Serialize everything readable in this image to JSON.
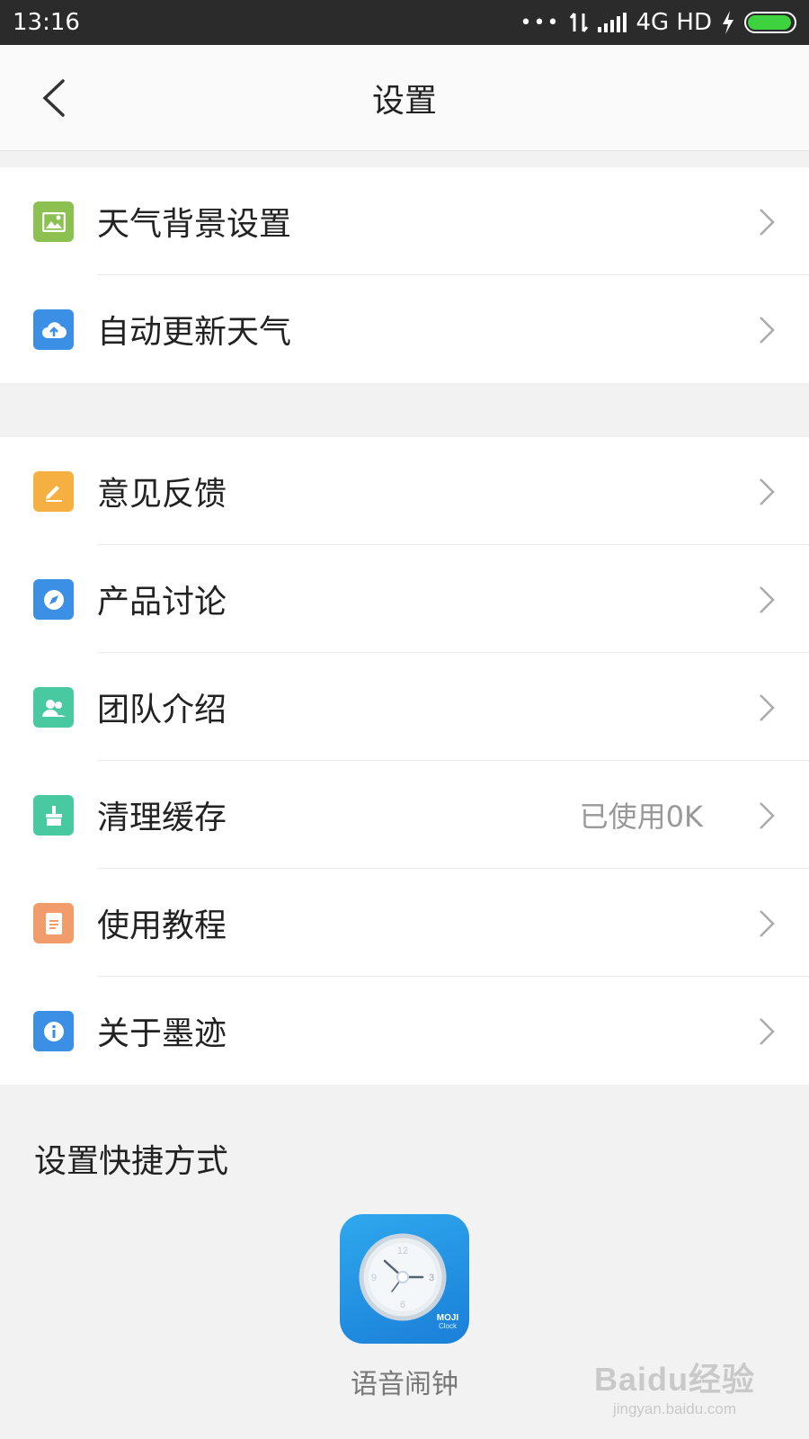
{
  "status_bar": {
    "time": "13:16",
    "dots": "•••",
    "network": "4G HD",
    "battery_level": 0.95,
    "battery_color": "#3fd23f"
  },
  "header": {
    "title": "设置",
    "back_icon": "chevron-left-icon"
  },
  "group1": {
    "items": [
      {
        "label": "天气背景设置",
        "icon": "image-icon",
        "color": "#8cc152"
      },
      {
        "label": "自动更新天气",
        "icon": "cloud-upload-icon",
        "color": "#3b8fe5"
      }
    ]
  },
  "group2": {
    "items": [
      {
        "label": "意见反馈",
        "icon": "edit-icon",
        "color": "#f5b041"
      },
      {
        "label": "产品讨论",
        "icon": "compass-icon",
        "color": "#3b8fe5"
      },
      {
        "label": "团队介绍",
        "icon": "team-icon",
        "color": "#48c9a0"
      },
      {
        "label": "清理缓存",
        "icon": "broom-icon",
        "color": "#48c9a0",
        "value": "已使用0K"
      },
      {
        "label": "使用教程",
        "icon": "document-icon",
        "color": "#f39c6b"
      },
      {
        "label": "关于墨迹",
        "icon": "info-icon",
        "color": "#3b8fe5"
      }
    ]
  },
  "shortcuts": {
    "title": "设置快捷方式",
    "items": [
      {
        "label": "语音闹钟",
        "icon": "clock-app-icon",
        "badge": "MOJI",
        "badge_sub": "Clock"
      }
    ]
  },
  "watermark": {
    "brand": "Baidu经验",
    "url": "jingyan.baidu.com"
  }
}
